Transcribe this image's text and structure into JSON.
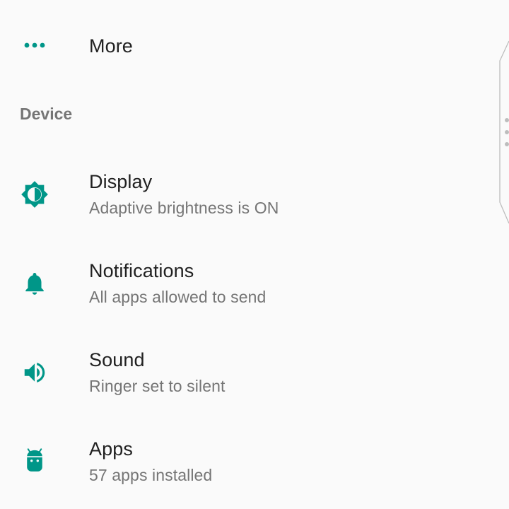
{
  "top_item": {
    "title": "More",
    "icon": "more-horiz-icon"
  },
  "section": {
    "header": "Device"
  },
  "items": [
    {
      "title": "Display",
      "subtitle": "Adaptive brightness is ON",
      "icon": "brightness-icon"
    },
    {
      "title": "Notifications",
      "subtitle": "All apps allowed to send",
      "icon": "bell-icon"
    },
    {
      "title": "Sound",
      "subtitle": "Ringer set to silent",
      "icon": "volume-icon"
    },
    {
      "title": "Apps",
      "subtitle": "57 apps installed",
      "icon": "android-icon"
    }
  ],
  "colors": {
    "accent": "#009688",
    "title_text": "#212121",
    "secondary_text": "#757575",
    "background": "#fafafa"
  }
}
